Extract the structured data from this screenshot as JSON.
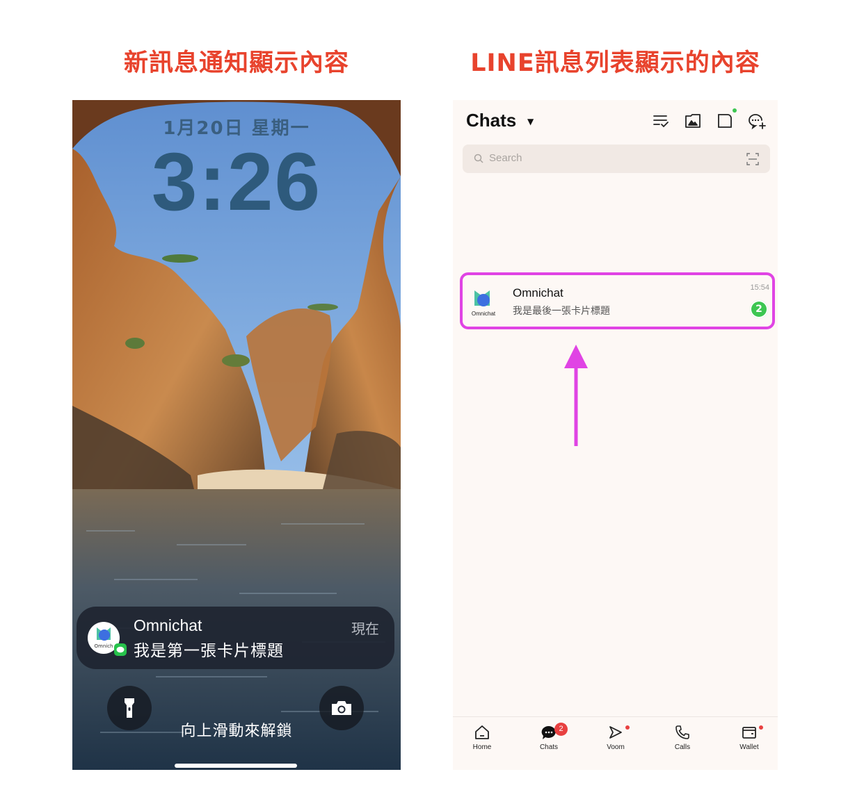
{
  "captions": {
    "left": "新訊息通知顯示內容",
    "right": "LINE訊息列表顯示的內容"
  },
  "lock_screen": {
    "date": "1月20日 星期一",
    "time": "3:26",
    "notification": {
      "app_name": "Omnichat",
      "message": "我是第一張卡片標題",
      "time": "現在",
      "icon": "omnichat-logo",
      "badge_icon": "line-app-icon",
      "icon_caption": "Omnich"
    },
    "unlock_hint": "向上滑動來解鎖",
    "buttons": [
      "flashlight-icon",
      "camera-icon"
    ]
  },
  "line_app": {
    "title": "Chats",
    "top_icons": [
      "edit-list-icon",
      "album-icon",
      "notes-icon",
      "new-chat-icon"
    ],
    "search": {
      "placeholder": "Search"
    },
    "chat": {
      "name": "Omnichat",
      "preview": "我是最後一張卡片標題",
      "time": "15:54",
      "unread": "2",
      "avatar_caption": "Omnichat"
    },
    "highlight_color": "#e044e4",
    "nav": [
      {
        "label": "Home",
        "icon": "home-icon"
      },
      {
        "label": "Chats",
        "icon": "chats-icon",
        "badge": "2"
      },
      {
        "label": "Voom",
        "icon": "voom-icon"
      },
      {
        "label": "Calls",
        "icon": "phone-icon"
      },
      {
        "label": "Wallet",
        "icon": "wallet-icon"
      }
    ]
  },
  "colors": {
    "caption": "#e8432d",
    "line_green": "#3dc651",
    "arrow": "#e044e4"
  }
}
